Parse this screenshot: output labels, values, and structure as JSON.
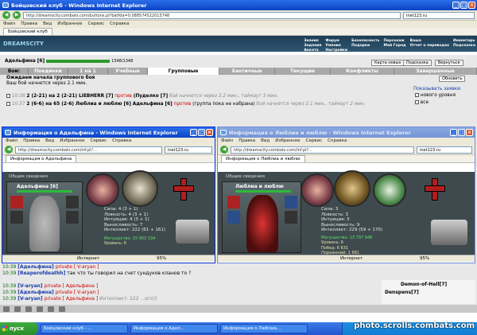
{
  "main": {
    "title": "Бойцовский клуб - Windows Internet Explorer",
    "url": "http://dreamscity.combats.com/buttons.pl?batfda=0.088574522015748",
    "search": "inet123.ru",
    "menu": [
      "Файл",
      "Правка",
      "Вид",
      "Избранное",
      "Сервис",
      "Справка"
    ],
    "tab": "Бойцовский клуб",
    "logo": "DREAMSCITY",
    "nav": [
      "Знания",
      "Форум",
      "Безопасность",
      "Персонаж",
      "Ваша",
      "Инвентарь",
      "Задания",
      "Умения",
      "Подарки",
      "Мой Город",
      "Отчет о переводах",
      "Подсказка",
      "Анкета",
      "Настройки"
    ],
    "player": "Адельфина [6]",
    "hp": "1348/1348",
    "btn_map": "Карта новых",
    "btn_hint": "Подсказка",
    "btn_back": "Вернуться",
    "boi": "Бои:",
    "tabs": [
      "Поединки",
      "1 на 1",
      "Учебные",
      "Групповые",
      "Хаотичные",
      "Текущие",
      "Конфликты",
      "Завершенные"
    ],
    "wait1": "Ожидаем начала группового боя",
    "wait2": "Ваш бой начнется через 2.1 мин.",
    "refresh": "Обновить",
    "show": "Показывать заявки",
    "opt_new": "нового уровня",
    "opt_all": "все",
    "row1_time": "10:38",
    "row1_text": "2 (2-21) на 2 (2-21) LIEBHERR [7]",
    "row1_vs": "против",
    "row1_b": "(Пуделко [7]",
    "row1_info": "бой начнется через 3.2 мин., таймаут 3 мин.",
    "row2_time": "10:37",
    "row2_text": "2 (6-6) на 65 (2-6)",
    "row2_a": "Люблиа и люблю [6]",
    "row2_b": "Адельфина [6]",
    "row2_vs": "против",
    "row2_c": "(группа пока не набрана)",
    "row2_info": "бой начнется через 2.1 мин., таймаут 2 мин."
  },
  "w1": {
    "title": "Информация о Адельфина - Windows Internet Explorer",
    "url": "http://dreamscity.combats.com/inf.pl?...",
    "search": "inet123.ru",
    "menu": [
      "Файл",
      "Правка",
      "Вид",
      "Избранное",
      "Сервис",
      "Справка"
    ],
    "tab": "Информация о Адельфина",
    "section": "Общие сведения",
    "name": "Адельфина [6]",
    "stats": [
      "Сила: 4 (3 + 1)",
      "Ловкость: 4 (3 + 1)",
      "Интуиция: 4 (3 + 1)",
      "Выносливость: 7",
      "Интеллект: 222 (61 + 161)"
    ],
    "money": "Могущество: 15 953 334",
    "level": "Уровень: 6",
    "status": "Интернет",
    "zoom": "95%"
  },
  "w2": {
    "title": "Информация о Люблиа и люблю - Windows Internet Explorer",
    "url": "http://dreamscity.combats.com/inf.pl?...",
    "search": "inet123.ru",
    "menu": [
      "Файл",
      "Правка",
      "Вид",
      "Избранное",
      "Сервис",
      "Справка"
    ],
    "tab": "Информация о Люблиа и люблю",
    "section": "Общие сведения",
    "name": "Люблиа и люблю",
    "stats": [
      "Сила: 3",
      "Ловкость: 3",
      "Интуиция: 3",
      "Выносливость: 9",
      "Интеллект: 229 (59 + 170)"
    ],
    "extra": [
      "Могущество: 13 797 948",
      "Уровень: 6",
      "Побед: 6 631",
      "Поражений: 1 681"
    ],
    "status": "Интернет",
    "zoom": "95%"
  },
  "chat": [
    {
      "time": "10:39",
      "name": "[Адельфина]",
      "rest": "private [ V-aryan ]"
    },
    {
      "time": "10:39",
      "name": "[Reaperofdeathh]",
      "rest": "так что ты говорил на счет сундуков кланов то ?"
    },
    {
      "time": "10:39",
      "name": "[V-aryan]",
      "rest": "private [ Адельфина ]"
    },
    {
      "time": "10:39",
      "name": "[Адельфина]",
      "rest": "private [ V-aryan ]"
    },
    {
      "time": "10:39",
      "name": "[V-aryan]",
      "rest": "private [ Адельфина ]",
      "extra": "Интеллект: 222 ...ого))"
    }
  ],
  "online": [
    "Demon-of-Hell[7]",
    "Denspens[7]"
  ],
  "taskbar": {
    "start": "пуск",
    "items": [
      "Бойцовский клуб - ...",
      "Информация о Адел...",
      "Информация о Люблиа..."
    ],
    "watermark": "photo.scrolls.combats.com"
  }
}
